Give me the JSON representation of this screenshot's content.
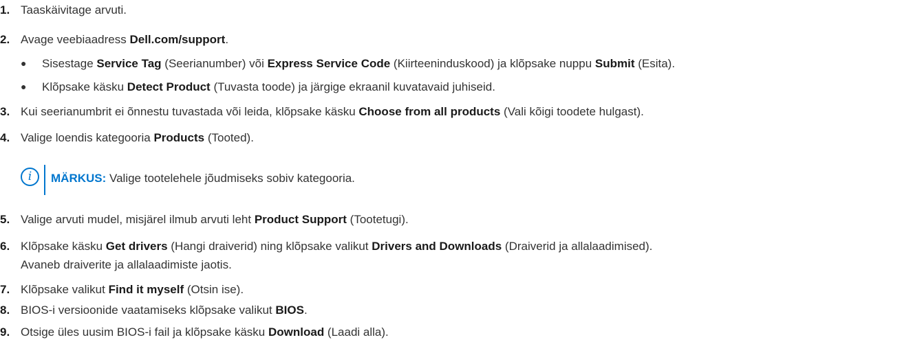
{
  "steps": [
    {
      "num": "1.",
      "parts": [
        "Taaskäivitage arvuti."
      ]
    },
    {
      "num": "2.",
      "parts": [
        "Avage veebiaadress ",
        "Dell.com/support",
        "."
      ]
    },
    {
      "num": "3.",
      "parts": [
        "Kui seerianumbrit ei õnnestu tuvastada või leida, klõpsake käsku ",
        "Choose from all products",
        " (Vali kõigi toodete hulgast)."
      ]
    },
    {
      "num": "4.",
      "parts": [
        "Valige loendis kategooria ",
        "Products",
        " (Tooted)."
      ]
    },
    {
      "num": "5.",
      "parts": [
        "Valige arvuti mudel, misjärel ilmub arvuti leht ",
        "Product Support",
        " (Tootetugi)."
      ]
    },
    {
      "num": "6.",
      "parts": [
        "Klõpsake käsku ",
        "Get drivers",
        " (Hangi draiverid) ning klõpsake valikut ",
        "Drivers and Downloads",
        " (Draiverid ja allalaadimised)."
      ],
      "line2": "Avaneb draiverite ja allalaadimiste jaotis."
    },
    {
      "num": "7.",
      "parts": [
        "Klõpsake valikut ",
        "Find it myself",
        " (Otsin ise)."
      ]
    },
    {
      "num": "8.",
      "parts": [
        "BIOS-i versioonide vaatamiseks klõpsake valikut ",
        "BIOS",
        "."
      ]
    },
    {
      "num": "9.",
      "parts": [
        "Otsige üles uusim BIOS-i fail ja klõpsake käsku ",
        "Download",
        " (Laadi alla)."
      ]
    }
  ],
  "bullets": [
    {
      "symbol": "●",
      "parts": [
        "Sisestage ",
        "Service Tag",
        " (Seerianumber) või ",
        "Express Service Code",
        " (Kiirteeninduskood) ja klõpsake nuppu ",
        "Submit",
        " (Esita)."
      ]
    },
    {
      "symbol": "●",
      "parts": [
        "Klõpsake käsku ",
        "Detect Product",
        " (Tuvasta toode) ja järgige ekraanil kuvatavaid juhiseid."
      ]
    }
  ],
  "note": {
    "icon": "i",
    "label": "MÄRKUS:",
    "text": " Valige tootelehele jõudmiseks sobiv kategooria."
  }
}
